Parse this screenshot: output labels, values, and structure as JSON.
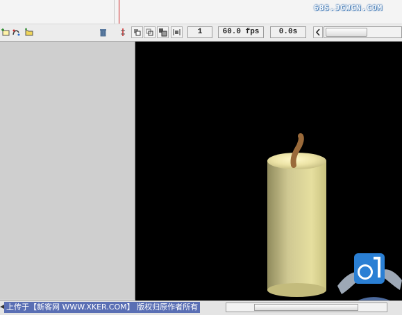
{
  "watermark": {
    "text": "68S.JCWCN.COM"
  },
  "toolbar": {
    "current_frame": "1",
    "frame_rate": "60.0 fps",
    "elapsed_time": "0.0s"
  },
  "icons": {
    "add_layer": "add-layer-icon",
    "add_guide": "add-guide-layer-icon",
    "add_folder": "add-folder-icon",
    "delete": "trash-icon",
    "center_frame": "center-frame-icon",
    "onion_skin": "onion-skin-icon",
    "onion_outlines": "onion-skin-outlines-icon",
    "edit_multiple": "edit-multiple-frames-icon",
    "onion_markers": "onion-markers-icon",
    "scroll_left": "chevron-left-icon"
  },
  "status": {
    "credit": "上传于【新客网 WWW.XKER.COM】 版权归原作者所有"
  },
  "colors": {
    "stage": "#000000",
    "candle_body": "#d9d39a",
    "wick": "#9a6a3a",
    "credit_bg": "#5a6fb4",
    "logo_blue": "#2a7fd4"
  }
}
